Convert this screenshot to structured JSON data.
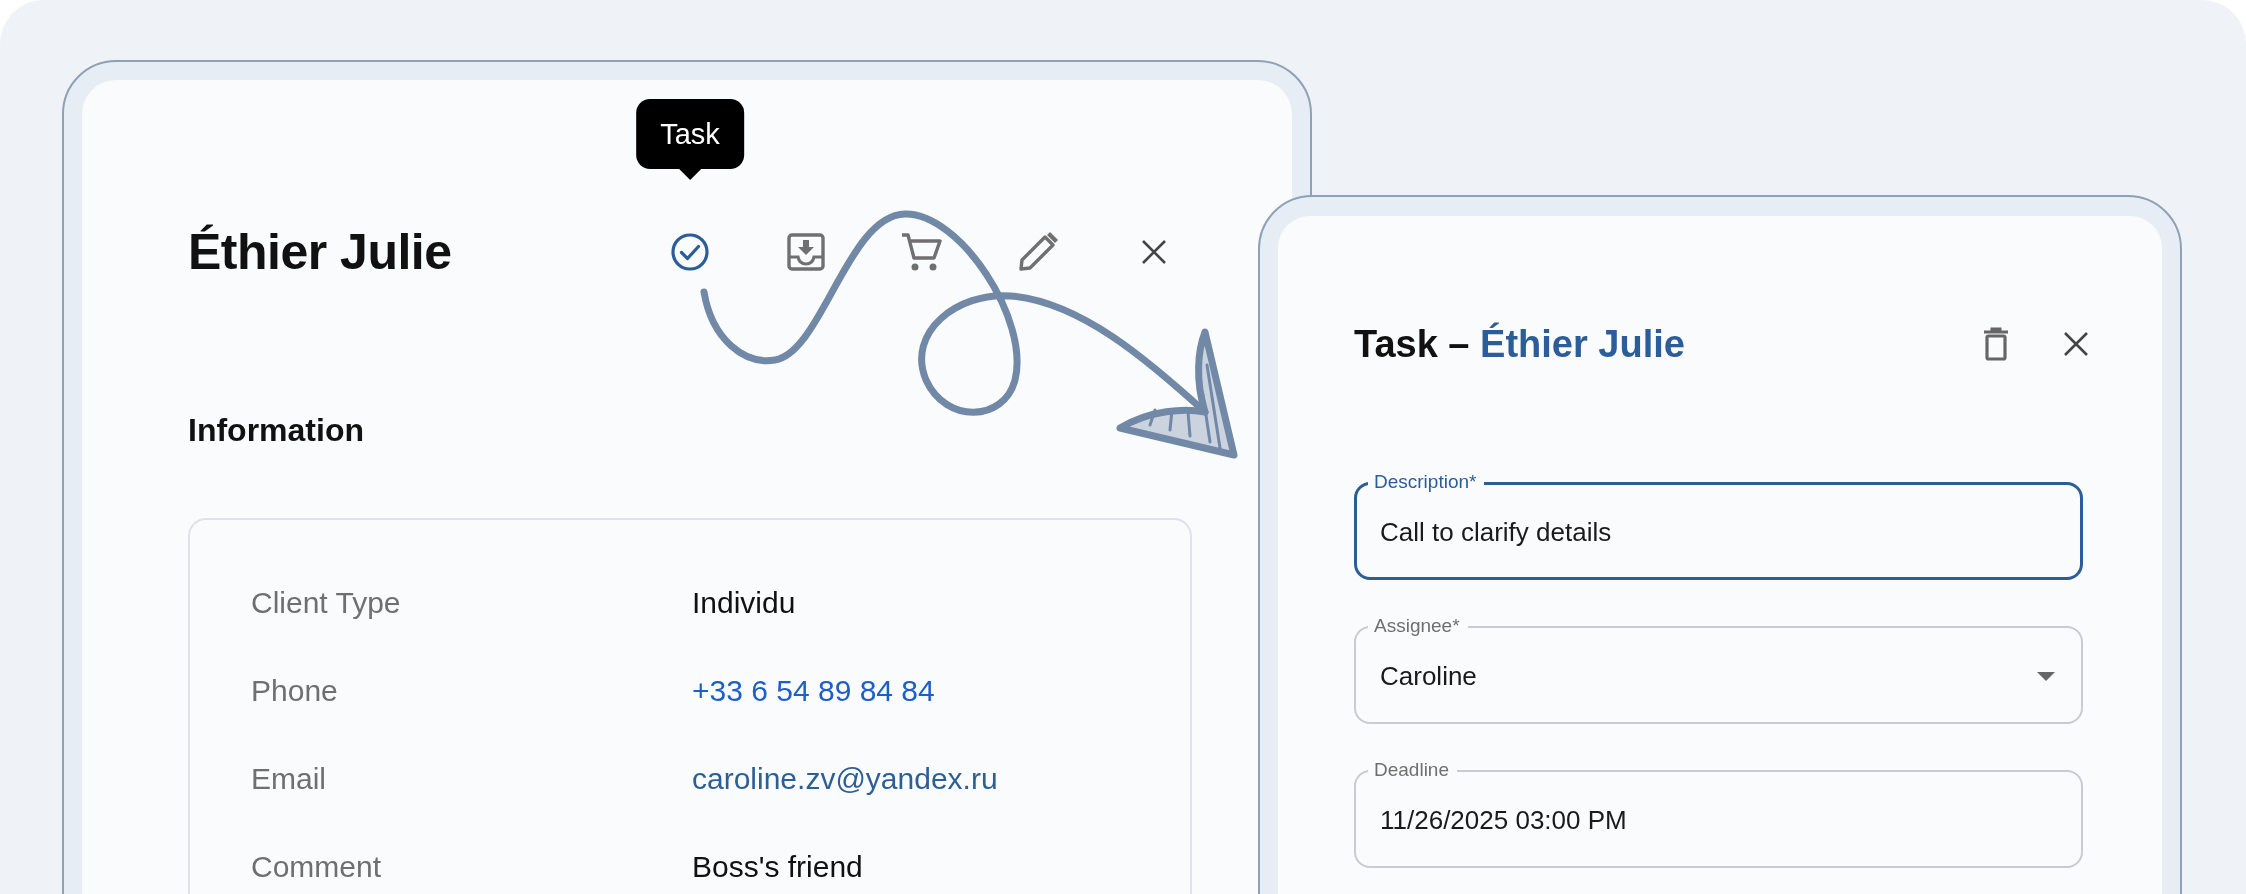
{
  "contact_card": {
    "title": "Éthier Julie",
    "toolbar": [
      {
        "kind": "task",
        "selected": true,
        "tooltip": "Task"
      },
      {
        "kind": "archive",
        "selected": false
      },
      {
        "kind": "cart",
        "selected": false
      },
      {
        "kind": "edit",
        "selected": false
      },
      {
        "kind": "close",
        "selected": false
      }
    ],
    "section_title": "Information",
    "fields": [
      {
        "label": "Client Type",
        "value": "Individu",
        "kind": "text"
      },
      {
        "label": "Phone",
        "value": "+33 6 54 89 84 84",
        "kind": "phone"
      },
      {
        "label": "Email",
        "value": "caroline.zv@yandex.ru",
        "kind": "email"
      },
      {
        "label": "Comment",
        "value": "Boss's friend",
        "kind": "text"
      }
    ]
  },
  "task_dialog": {
    "title": "Task –",
    "contact": "Éthier Julie",
    "fields": [
      {
        "label": "Description*",
        "value": "Call to clarify details",
        "kind": "text",
        "focused": true
      },
      {
        "label": "Assignee*",
        "value": "Caroline",
        "kind": "select",
        "focused": false
      },
      {
        "label": "Deadline",
        "value": "11/26/2025 03:00 PM",
        "kind": "text",
        "focused": false
      }
    ]
  }
}
